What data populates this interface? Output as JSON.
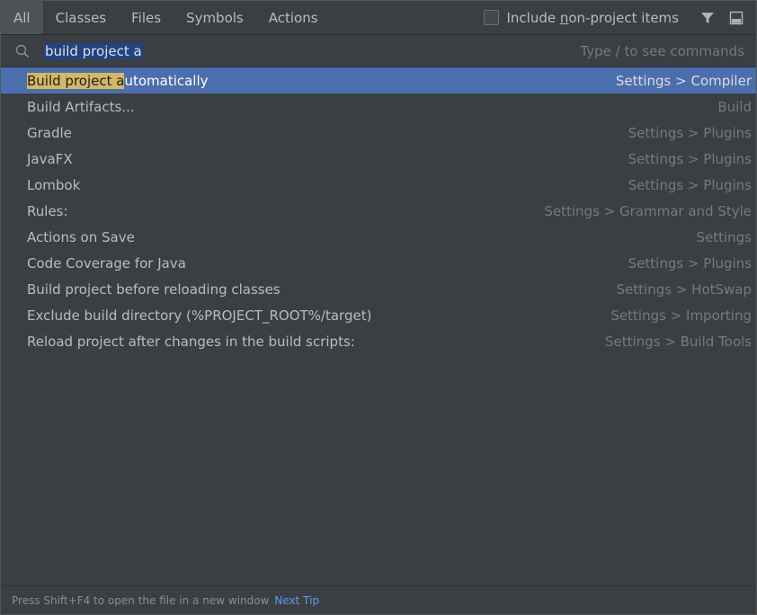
{
  "tabs": [
    {
      "label": "All",
      "active": true
    },
    {
      "label": "Classes",
      "active": false
    },
    {
      "label": "Files",
      "active": false
    },
    {
      "label": "Symbols",
      "active": false
    },
    {
      "label": "Actions",
      "active": false
    }
  ],
  "include_checkbox": {
    "label_pre": "Include ",
    "label_mnemonic": "n",
    "label_post": "on-project items",
    "checked": false
  },
  "search": {
    "value": "build project a",
    "hint": "Type / to see commands"
  },
  "results": [
    {
      "highlight": "Build project a",
      "rest": "utomatically",
      "location": "Settings > Compiler",
      "selected": true
    },
    {
      "label": "Build Artifacts...",
      "location": "Build"
    },
    {
      "label": "Gradle",
      "location": "Settings > Plugins"
    },
    {
      "label": "JavaFX",
      "location": "Settings > Plugins"
    },
    {
      "label": "Lombok",
      "location": "Settings > Plugins"
    },
    {
      "label": "Rules:",
      "location": "Settings > Grammar and Style"
    },
    {
      "label": "Actions on Save",
      "location": "Settings"
    },
    {
      "label": "Code Coverage for Java",
      "location": "Settings > Plugins"
    },
    {
      "label": "Build project before reloading classes",
      "location": "Settings > HotSwap"
    },
    {
      "label": "Exclude build directory (%PROJECT_ROOT%/target)",
      "location": "Settings > Importing"
    },
    {
      "label": "Reload project after changes in the build scripts:",
      "location": "Settings > Build Tools"
    }
  ],
  "footer": {
    "tip": "Press Shift+F4 to open the file in a new window",
    "link": "Next Tip"
  },
  "colors": {
    "selection": "#4b6eaf",
    "highlight": "#d6b763",
    "link": "#589df6"
  }
}
